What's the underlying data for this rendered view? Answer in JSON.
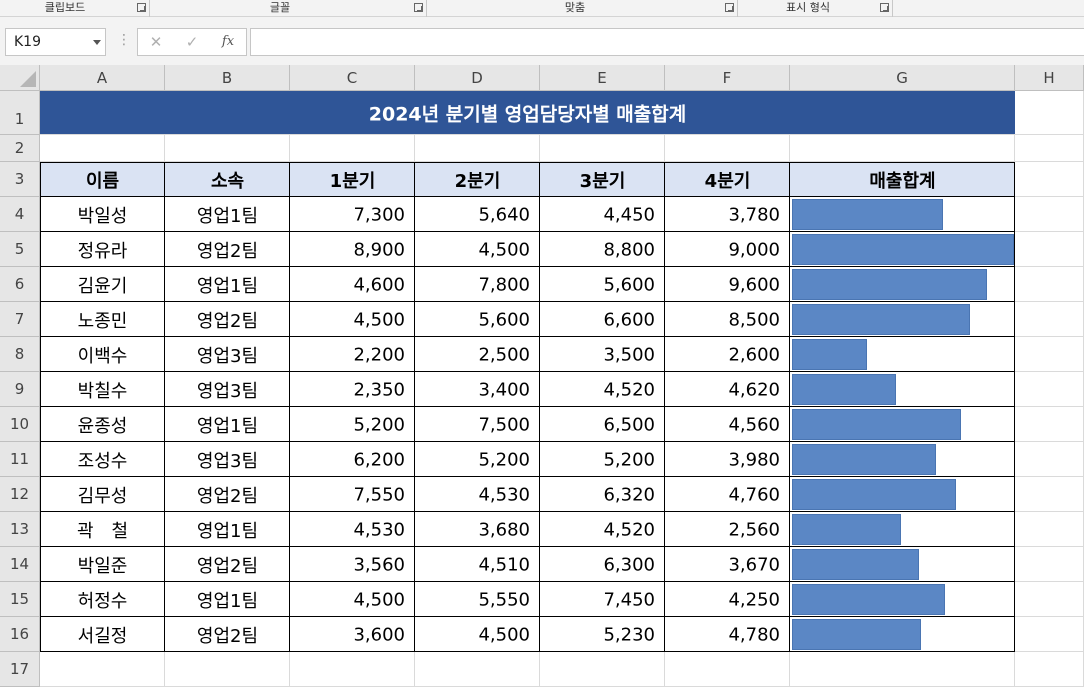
{
  "ribbon": {
    "groups": [
      "클립보드",
      "글꼴",
      "맞춤",
      "표시 형식"
    ]
  },
  "formula_bar": {
    "name_box": "K19",
    "cancel_icon": "✕",
    "enter_icon": "✓",
    "fx_label": "fx",
    "formula": ""
  },
  "columns": [
    "A",
    "B",
    "C",
    "D",
    "E",
    "F",
    "G",
    "H"
  ],
  "rows": [
    "1",
    "2",
    "3",
    "4",
    "5",
    "6",
    "7",
    "8",
    "9",
    "10",
    "11",
    "12",
    "13",
    "14",
    "15",
    "16",
    "17"
  ],
  "sheet": {
    "title": "2024년 분기별 영업담당자별 매출합계",
    "headers": [
      "이름",
      "소속",
      "1분기",
      "2분기",
      "3분기",
      "4분기",
      "매출합계"
    ],
    "records": [
      {
        "name": "박일성",
        "team": "영업1팀",
        "q1": "7,300",
        "q2": "5,640",
        "q3": "4,450",
        "q4": "3,780",
        "total_bar": 0.68
      },
      {
        "name": "정유라",
        "team": "영업2팀",
        "q1": "8,900",
        "q2": "4,500",
        "q3": "8,800",
        "q4": "9,000",
        "total_bar": 1.0
      },
      {
        "name": "김윤기",
        "team": "영업1팀",
        "q1": "4,600",
        "q2": "7,800",
        "q3": "5,600",
        "q4": "9,600",
        "total_bar": 0.88
      },
      {
        "name": "노종민",
        "team": "영업2팀",
        "q1": "4,500",
        "q2": "5,600",
        "q3": "6,600",
        "q4": "8,500",
        "total_bar": 0.8
      },
      {
        "name": "이백수",
        "team": "영업3팀",
        "q1": "2,200",
        "q2": "2,500",
        "q3": "3,500",
        "q4": "2,600",
        "total_bar": 0.34
      },
      {
        "name": "박칠수",
        "team": "영업3팀",
        "q1": "2,350",
        "q2": "3,400",
        "q3": "4,520",
        "q4": "4,620",
        "total_bar": 0.47
      },
      {
        "name": "윤종성",
        "team": "영업1팀",
        "q1": "5,200",
        "q2": "7,500",
        "q3": "6,500",
        "q4": "4,560",
        "total_bar": 0.76
      },
      {
        "name": "조성수",
        "team": "영업3팀",
        "q1": "6,200",
        "q2": "5,200",
        "q3": "5,200",
        "q4": "3,980",
        "total_bar": 0.65
      },
      {
        "name": "김무성",
        "team": "영업2팀",
        "q1": "7,550",
        "q2": "4,530",
        "q3": "6,320",
        "q4": "4,760",
        "total_bar": 0.74
      },
      {
        "name": "곽　철",
        "team": "영업1팀",
        "q1": "4,530",
        "q2": "3,680",
        "q3": "4,520",
        "q4": "2,560",
        "total_bar": 0.49
      },
      {
        "name": "박일준",
        "team": "영업2팀",
        "q1": "3,560",
        "q2": "4,510",
        "q3": "6,300",
        "q4": "3,670",
        "total_bar": 0.57
      },
      {
        "name": "허정수",
        "team": "영업1팀",
        "q1": "4,500",
        "q2": "5,550",
        "q3": "7,450",
        "q4": "4,250",
        "total_bar": 0.69
      },
      {
        "name": "서길정",
        "team": "영업2팀",
        "q1": "3,600",
        "q2": "4,500",
        "q3": "5,230",
        "q4": "4,780",
        "total_bar": 0.58
      }
    ]
  },
  "colors": {
    "title_fill": "#2f5597",
    "header_fill": "#dae3f3",
    "databar": "#5b87c5"
  }
}
